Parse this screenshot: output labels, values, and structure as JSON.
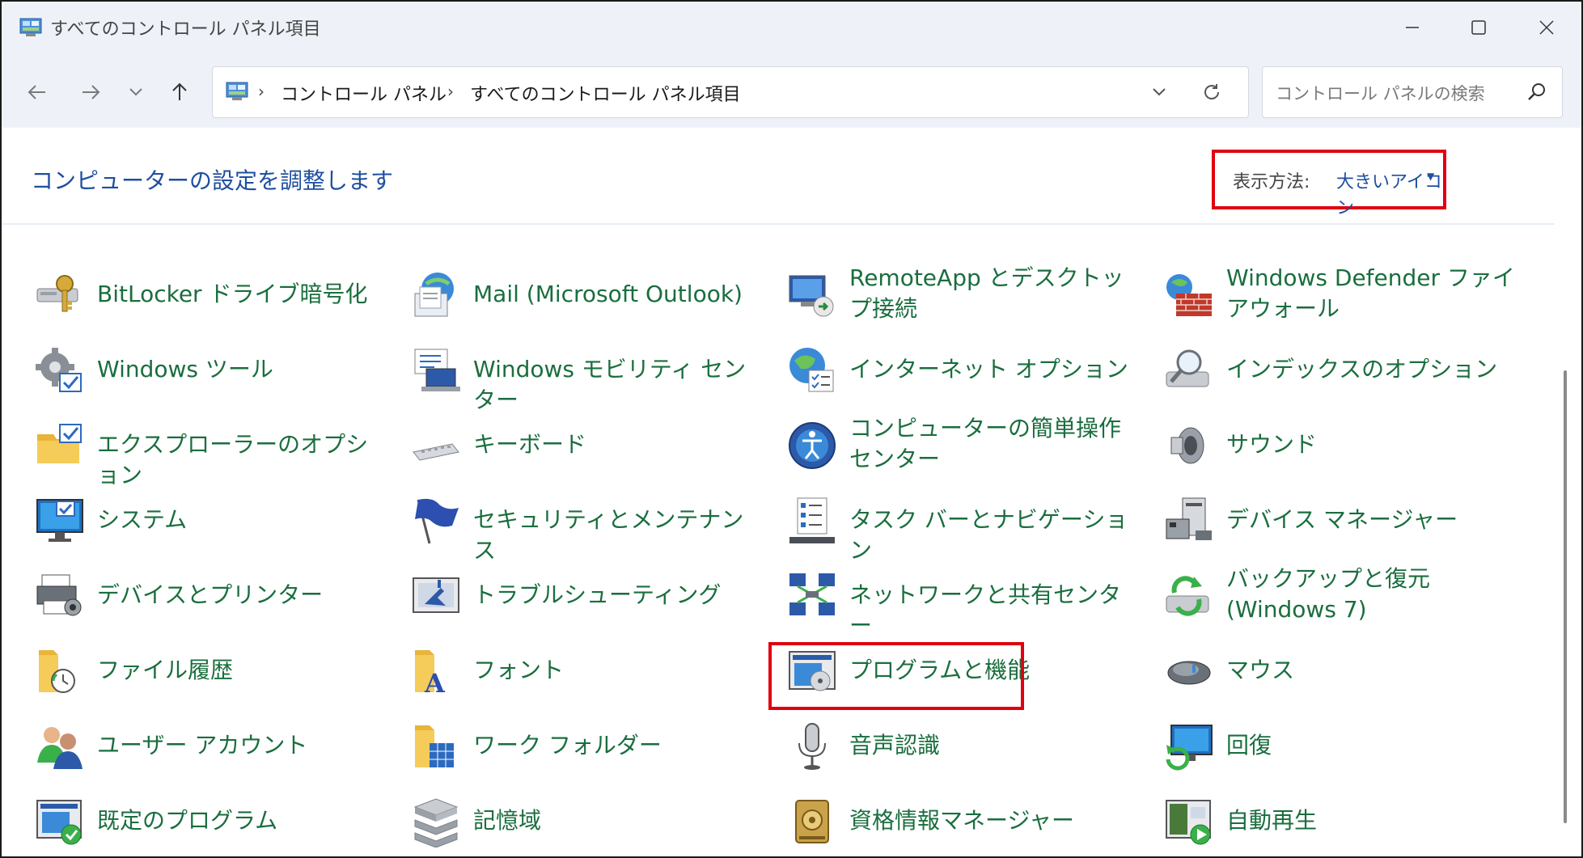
{
  "window": {
    "title": "すべてのコントロール パネル項目"
  },
  "toolbar": {
    "breadcrumbs": [
      "コントロール パネル",
      "すべてのコントロール パネル項目"
    ],
    "search_placeholder": "コントロール パネルの検索"
  },
  "content": {
    "heading": "コンピューターの設定を調整します",
    "view_by_label": "表示方法:",
    "view_by_value": "大きいアイコン"
  },
  "items": [
    {
      "label": "BitLocker ドライブ暗号化",
      "icon": "bitlocker-icon"
    },
    {
      "label": "Mail (Microsoft Outlook)",
      "icon": "mail-icon"
    },
    {
      "label": "RemoteApp とデスクトップ接続",
      "icon": "remoteapp-icon"
    },
    {
      "label": "Windows Defender ファイアウォール",
      "icon": "firewall-icon"
    },
    {
      "label": "Windows ツール",
      "icon": "windows-tools-icon"
    },
    {
      "label": "Windows モビリティ センター",
      "icon": "mobility-center-icon"
    },
    {
      "label": "インターネット オプション",
      "icon": "internet-options-icon"
    },
    {
      "label": "インデックスのオプション",
      "icon": "indexing-options-icon"
    },
    {
      "label": "エクスプローラーのオプション",
      "icon": "explorer-options-icon"
    },
    {
      "label": "キーボード",
      "icon": "keyboard-icon"
    },
    {
      "label": "コンピューターの簡単操作センター",
      "icon": "ease-of-access-icon"
    },
    {
      "label": "サウンド",
      "icon": "sound-icon"
    },
    {
      "label": "システム",
      "icon": "system-icon"
    },
    {
      "label": "セキュリティとメンテナンス",
      "icon": "security-maintenance-icon"
    },
    {
      "label": "タスク バーとナビゲーション",
      "icon": "taskbar-icon"
    },
    {
      "label": "デバイス マネージャー",
      "icon": "device-manager-icon"
    },
    {
      "label": "デバイスとプリンター",
      "icon": "devices-printers-icon"
    },
    {
      "label": "トラブルシューティング",
      "icon": "troubleshooting-icon"
    },
    {
      "label": "ネットワークと共有センター",
      "icon": "network-sharing-icon"
    },
    {
      "label": "バックアップと復元 (Windows 7)",
      "icon": "backup-restore-icon"
    },
    {
      "label": "ファイル履歴",
      "icon": "file-history-icon"
    },
    {
      "label": "フォント",
      "icon": "fonts-icon"
    },
    {
      "label": "プログラムと機能",
      "icon": "programs-features-icon"
    },
    {
      "label": "マウス",
      "icon": "mouse-icon"
    },
    {
      "label": "ユーザー アカウント",
      "icon": "user-accounts-icon"
    },
    {
      "label": "ワーク フォルダー",
      "icon": "work-folders-icon"
    },
    {
      "label": "音声認識",
      "icon": "speech-recognition-icon"
    },
    {
      "label": "回復",
      "icon": "recovery-icon"
    },
    {
      "label": "既定のプログラム",
      "icon": "default-programs-icon"
    },
    {
      "label": "記憶域",
      "icon": "storage-spaces-icon"
    },
    {
      "label": "資格情報マネージャー",
      "icon": "credential-manager-icon"
    },
    {
      "label": "自動再生",
      "icon": "autoplay-icon"
    }
  ],
  "colors": {
    "link_green": "#1a6e3e",
    "heading_blue": "#1e4fa0",
    "highlight_red": "#e00010",
    "chrome_bg": "#eef2f8"
  }
}
